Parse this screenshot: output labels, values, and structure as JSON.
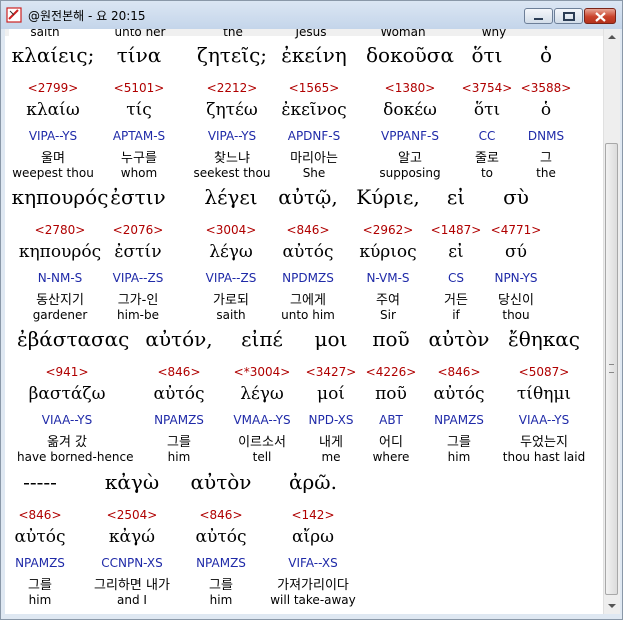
{
  "window": {
    "title": "@원전본해 - 요 20:15"
  },
  "partial_row": [
    "saith",
    "unto her",
    "the",
    "Jesus",
    "Woman",
    "why"
  ],
  "rows": [
    {
      "words": [
        {
          "greek": "κλαίεις;",
          "strong": "<2799>",
          "lemma": "κλαίω",
          "parse": "VIPA--YS",
          "kor": "울며",
          "eng": "weepest thou"
        },
        {
          "greek": "τίνα",
          "strong": "<5101>",
          "lemma": "τίς",
          "parse": "APTAM-S",
          "kor": "누구를",
          "eng": "whom"
        },
        {
          "greek": "ζητεῖς;",
          "strong": "<2212>",
          "lemma": "ζητέω",
          "parse": "VIPA--YS",
          "kor": "찾느냐",
          "eng": "seekest thou"
        },
        {
          "greek": "ἐκείνη",
          "strong": "<1565>",
          "lemma": "ἐκεῖνος",
          "parse": "APDNF-S",
          "kor": "마리아는",
          "eng": "She"
        },
        {
          "greek": "δοκοῦσα",
          "strong": "<1380>",
          "lemma": "δοκέω",
          "parse": "VPPANF-S",
          "kor": "알고",
          "eng": "supposing"
        },
        {
          "greek": "ὅτι",
          "strong": "<3754>",
          "lemma": "ὅτι",
          "parse": "CC",
          "kor": "줄로",
          "eng": "to"
        },
        {
          "greek": "ὁ",
          "strong": "<3588>",
          "lemma": "ὁ",
          "parse": "DNMS",
          "kor": "그",
          "eng": "the"
        }
      ]
    },
    {
      "words": [
        {
          "greek": "κηπουρός",
          "strong": "<2780>",
          "lemma": "κηπουρός",
          "parse": "N-NM-S",
          "kor": "동산지기",
          "eng": "gardener"
        },
        {
          "greek": "ἐστιν",
          "strong": "<2076>",
          "lemma": "ἐστίν",
          "parse": "VIPA--ZS",
          "kor": "그가-인",
          "eng": "him-be"
        },
        {
          "greek": "λέγει",
          "strong": "<3004>",
          "lemma": "λέγω",
          "parse": "VIPA--ZS",
          "kor": "가로되",
          "eng": "saith"
        },
        {
          "greek": "αὐτῷ,",
          "strong": "<846>",
          "lemma": "αὐτός",
          "parse": "NPDMZS",
          "kor": "그에게",
          "eng": "unto him"
        },
        {
          "greek": "Κύριε,",
          "strong": "<2962>",
          "lemma": "κύριος",
          "parse": "N-VM-S",
          "kor": "주여",
          "eng": "Sir"
        },
        {
          "greek": "εἰ",
          "strong": "<1487>",
          "lemma": "εἰ",
          "parse": "CS",
          "kor": "거든",
          "eng": "if"
        },
        {
          "greek": "σὺ",
          "strong": "<4771>",
          "lemma": "σύ",
          "parse": "NPN-YS",
          "kor": "당신이",
          "eng": "thou"
        }
      ]
    },
    {
      "words": [
        {
          "greek": "ἐβάστασας",
          "strong": "<941>",
          "lemma": "βαστάζω",
          "parse": "VIAA--YS",
          "kor": "옮겨 갔",
          "eng": "have borned-hence"
        },
        {
          "greek": "αὐτόν,",
          "strong": "<846>",
          "lemma": "αὐτός",
          "parse": "NPAMZS",
          "kor": "그를",
          "eng": "him"
        },
        {
          "greek": "εἰπέ",
          "strong": "<*3004>",
          "lemma": "λέγω",
          "parse": "VMAA--YS",
          "kor": "이르소서",
          "eng": "tell"
        },
        {
          "greek": "μοι",
          "strong": "<3427>",
          "lemma": "μοί",
          "parse": "NPD-XS",
          "kor": "내게",
          "eng": "me"
        },
        {
          "greek": "ποῦ",
          "strong": "<4226>",
          "lemma": "ποῦ",
          "parse": "ABT",
          "kor": "어디",
          "eng": "where"
        },
        {
          "greek": "αὐτὸν",
          "strong": "<846>",
          "lemma": "αὐτός",
          "parse": "NPAMZS",
          "kor": "그를",
          "eng": "him"
        },
        {
          "greek": "ἔθηκας",
          "strong": "<5087>",
          "lemma": "τίθημι",
          "parse": "VIAA--YS",
          "kor": "두었는지",
          "eng": "thou hast laid"
        }
      ]
    },
    {
      "words": [
        {
          "greek": "-----",
          "strong": "<846>",
          "lemma": "αὐτός",
          "parse": "NPAMZS",
          "kor": "그를",
          "eng": "him"
        },
        {
          "greek": "κἀγὼ",
          "strong": "<2504>",
          "lemma": "κἀγώ",
          "parse": "CCNPN-XS",
          "kor": "그리하면 내가",
          "eng": "and I"
        },
        {
          "greek": "αὐτὸν",
          "strong": "<846>",
          "lemma": "αὐτός",
          "parse": "NPAMZS",
          "kor": "그를",
          "eng": "him"
        },
        {
          "greek": "ἀρῶ.",
          "strong": "<142>",
          "lemma": "αἴρω",
          "parse": "VIFA--XS",
          "kor": "가져가리이다",
          "eng": "will take-away"
        }
      ]
    }
  ]
}
